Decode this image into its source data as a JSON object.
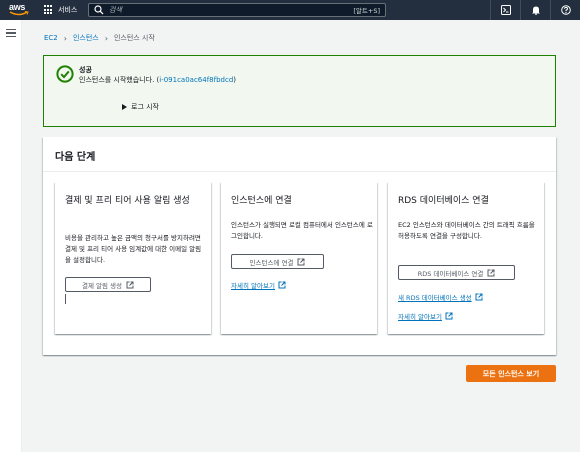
{
  "nav": {
    "logo_text": "aws",
    "services_label": "서비스",
    "search_placeholder": "검색",
    "search_shortcut": "[알트+S]"
  },
  "breadcrumb": {
    "items": [
      "EC2",
      "인스턴스",
      "인스턴스 시작"
    ]
  },
  "alert": {
    "title": "성공",
    "message_prefix": "인스턴스를 시작했습니다. (",
    "instance_id": "i-091ca0ac64f8fbdcd",
    "message_suffix": ")",
    "log_label": "로그 시작"
  },
  "next_steps": {
    "title": "다음 단계",
    "cards": [
      {
        "title": "결제 및 프리 티어 사용 알림 생성",
        "description": "비용을 관리하고 높은 금액의 청구서를 방지하려면 결제 및 프리 티어 사용 임계값에 대한 이메일 알림을 설정합니다.",
        "button": "결제 알림 생성"
      },
      {
        "title": "인스턴스에 연결",
        "description": "인스턴스가 실행되면 로컬 컴퓨터에서 인스턴스에 로그인합니다.",
        "button": "인스턴스에 연결",
        "link": "자세히 알아보기"
      },
      {
        "title": "RDS 데이터베이스 연결",
        "description": "EC2 인스턴스와 데이터베이스 간의 트래픽 흐름을 허용하도록 연결을 구성합니다.",
        "button": "RDS 데이터베이스 연결",
        "link1": "새 RDS 데이터베이스 생성",
        "link2": "자세히 알아보기"
      }
    ]
  },
  "primary_button": "모든 인스턴스 보기",
  "colors": {
    "nav_bg": "#232f3e",
    "success": "#1d8102",
    "link": "#0073bb",
    "primary": "#ec7211"
  },
  "icons": [
    "aws-logo",
    "grid-icon",
    "search-icon",
    "cloudshell-icon",
    "bell-icon",
    "help-icon",
    "menu-icon",
    "success-check-icon",
    "caret-right-icon",
    "external-link-icon"
  ]
}
